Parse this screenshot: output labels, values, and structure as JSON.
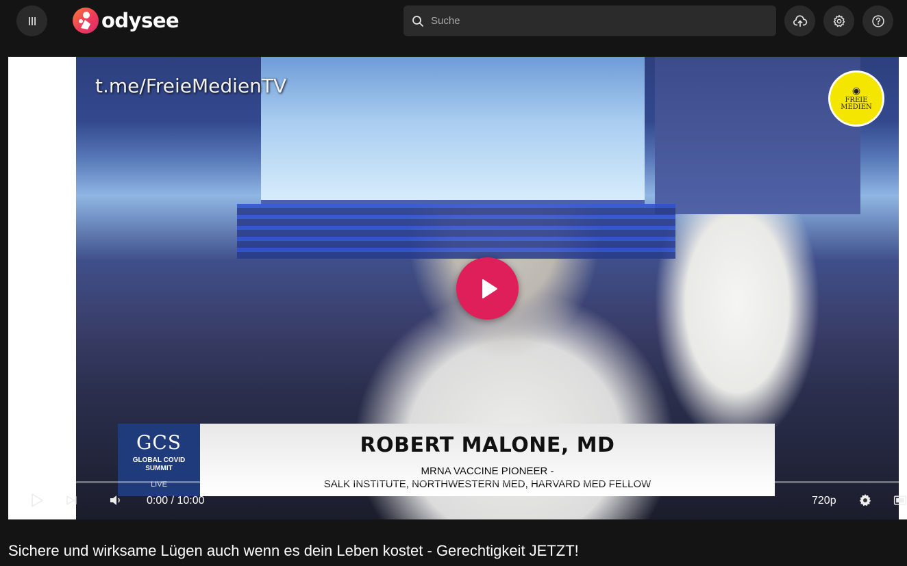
{
  "header": {
    "menu_icon": "menu-icon",
    "logo_text": "odysee",
    "search": {
      "placeholder": "Suche",
      "value": ""
    },
    "buttons": [
      {
        "icon": "upload-cloud-icon"
      },
      {
        "icon": "gear-icon"
      },
      {
        "icon": "help-icon"
      }
    ]
  },
  "video": {
    "watermark": "t.me/FreieMedienTV",
    "badge": {
      "line1": "FREIE",
      "line2": "MEDIEN"
    },
    "lower_third": {
      "logo_title": "GCS",
      "logo_sub_line1": "GLOBAL COVID",
      "logo_sub_line2": "SUMMIT",
      "live": "LIVE",
      "name": "ROBERT MALONE, MD",
      "role_line1": "MRNA VACCINE PIONEER -",
      "role_line2": "SALK INSTITUTE, NORTHWESTERN MED, HARVARD MED FELLOW"
    }
  },
  "player": {
    "progress_fraction": 0.0,
    "time_current": "0:00",
    "time_separator": " / ",
    "time_total": "10:00",
    "quality": "720p",
    "colors": {
      "accent": "#de1f5a"
    }
  },
  "title": "Sichere und wirksame Lügen auch wenn es dein Leben kostet - Gerechtigkeit JETZT!"
}
